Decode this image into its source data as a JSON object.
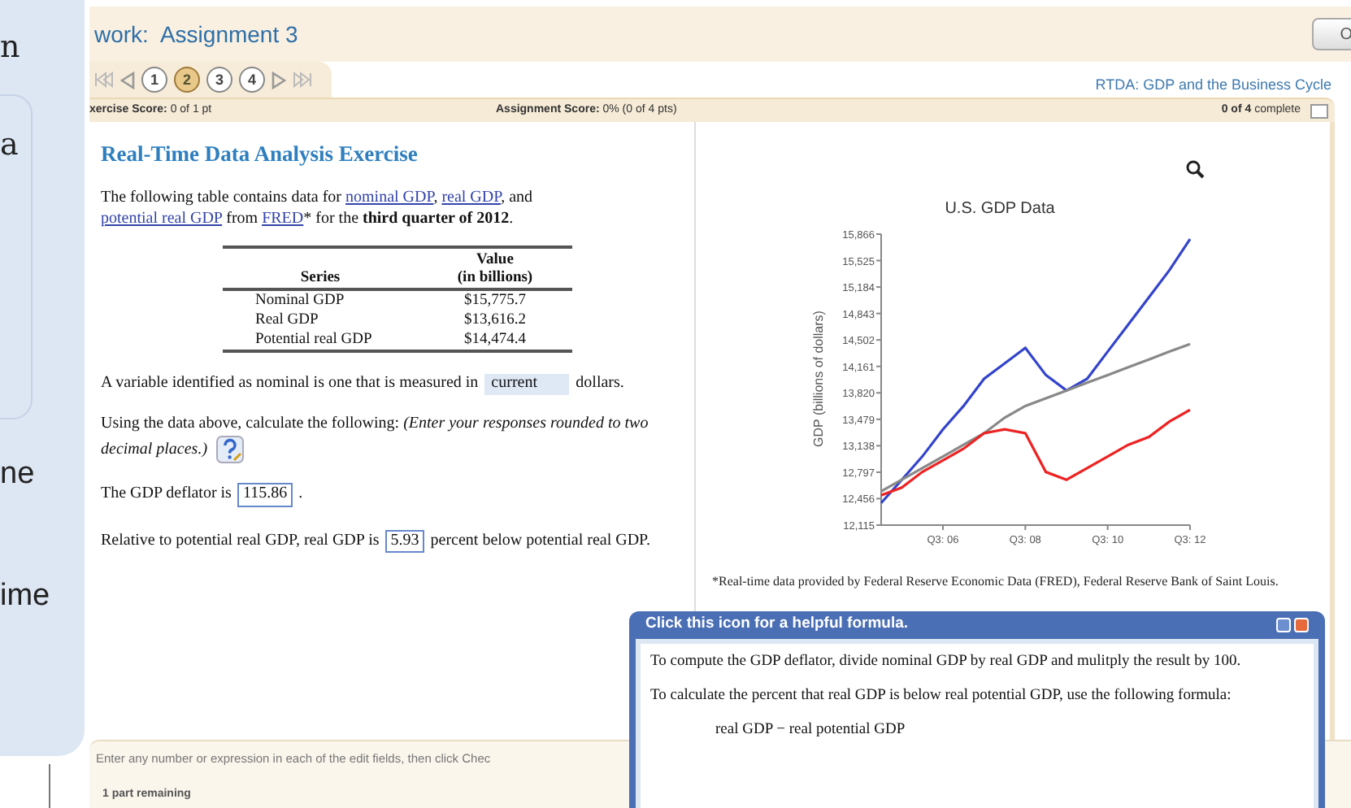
{
  "side_panel": {
    "texts": [
      "n",
      "a",
      "ne",
      "ime"
    ]
  },
  "header": {
    "title": "work:  Assignment 3",
    "button": "O"
  },
  "question_nav": {
    "items": [
      {
        "label": "1",
        "selected": false
      },
      {
        "label": "2",
        "selected": true
      },
      {
        "label": "3",
        "selected": false
      },
      {
        "label": "4",
        "selected": false
      }
    ],
    "exercise_title": "RTDA: GDP and the Business Cycle"
  },
  "score_bar": {
    "exercise_label": "xercise Score:",
    "exercise_value": "0 of 1 pt",
    "assignment_label": "Assignment Score:",
    "assignment_value": "0% (0 of 4 pts)",
    "complete_count": "0 of 4",
    "complete_label": "complete"
  },
  "exercise": {
    "heading": "Real-Time Data Analysis Exercise",
    "intro": [
      {
        "text": "The following table contains data for ",
        "kind": "plain"
      },
      {
        "text": "nominal GDP",
        "kind": "link"
      },
      {
        "text": ", ",
        "kind": "plain"
      },
      {
        "text": "real GDP",
        "kind": "link"
      },
      {
        "text": ", and ",
        "kind": "plain"
      },
      {
        "text": "potential real GDP",
        "kind": "link"
      },
      {
        "text": " from ",
        "kind": "plain"
      },
      {
        "text": "FRED",
        "kind": "link"
      },
      {
        "text": "* for the **third quarter of 2012**.",
        "kind": "plain"
      }
    ],
    "table": {
      "columns": [
        "Series",
        "Value\n(in billions)"
      ],
      "rows": [
        [
          "Nominal GDP",
          "$15,775.7"
        ],
        [
          "Real GDP",
          "$13,616.2"
        ],
        [
          "Potential real GDP",
          "$14,474.4"
        ]
      ]
    },
    "q1": {
      "before": "A variable identified as nominal is one that is measured in",
      "value": "current",
      "after": "dollars."
    },
    "instructions": {
      "text": "Using the data above, calculate the following:",
      "hint": "(Enter your responses rounded to two decimal places.)"
    },
    "q2": {
      "before": "The GDP deflator is",
      "value": "115.86",
      "after": "."
    },
    "q3": {
      "before": "Relative to potential real GDP, real GDP is",
      "value": "5.93",
      "after": "percent below potential real GDP."
    }
  },
  "chart_panel": {
    "chart_data": {
      "type": "line",
      "title": "U.S. GDP Data",
      "ylabel": "GDP (billions of dollars)",
      "categories": [
        null,
        null,
        null,
        "Q3: 06",
        null,
        null,
        null,
        "Q3: 08",
        null,
        null,
        null,
        "Q3: 10",
        null,
        null,
        null,
        "Q3: 12"
      ],
      "series": [
        {
          "color": "#3344cc",
          "values": [
            12400,
            12700,
            13000,
            13350,
            13650,
            14000,
            14200,
            14400,
            14050,
            13850,
            14000,
            14350,
            14700,
            15050,
            15400,
            15800
          ]
        },
        {
          "color": "#888888",
          "values": [
            12550,
            12700,
            12850,
            13000,
            13150,
            13300,
            13500,
            13650,
            13750,
            13850,
            13950,
            14050,
            14150,
            14250,
            14350,
            14450
          ]
        },
        {
          "color": "#ee2222",
          "values": [
            12500,
            12600,
            12800,
            12950,
            13100,
            13300,
            13350,
            13300,
            12800,
            12700,
            12850,
            13000,
            13150,
            13250,
            13450,
            13600
          ]
        }
      ],
      "ylim": [
        12115,
        15866
      ],
      "yticks": [
        {
          "value": 12115,
          "label": "12,115"
        },
        {
          "value": 12456,
          "label": "12,456"
        },
        {
          "value": 12797,
          "label": "12,797"
        },
        {
          "value": 13138,
          "label": "13,138"
        },
        {
          "value": 13479,
          "label": "13,479"
        },
        {
          "value": 13820,
          "label": "13,820"
        },
        {
          "value": 14161,
          "label": "14,161"
        },
        {
          "value": 14502,
          "label": "14,502"
        },
        {
          "value": 14843,
          "label": "14,843"
        },
        {
          "value": 15184,
          "label": "15,184"
        },
        {
          "value": 15525,
          "label": "15,525"
        },
        {
          "value": 15866,
          "label": "15,866"
        }
      ]
    },
    "footnote": "*Real-time data provided by Federal Reserve Economic Data (FRED), Federal Reserve Bank of Saint Louis."
  },
  "footer": {
    "instruction": "Enter any number or expression in each of the edit fields, then click Chec",
    "remaining": "1 part remaining"
  },
  "popup": {
    "title": "Click this icon for a helpful formula.",
    "paragraphs": [
      "To compute the GDP deflator, divide nominal GDP by real GDP and mulitply the result by 100.",
      "To calculate the percent that real GDP is below real potential GDP, use the following formula:"
    ],
    "formula": "real GDP − real potential GDP"
  }
}
